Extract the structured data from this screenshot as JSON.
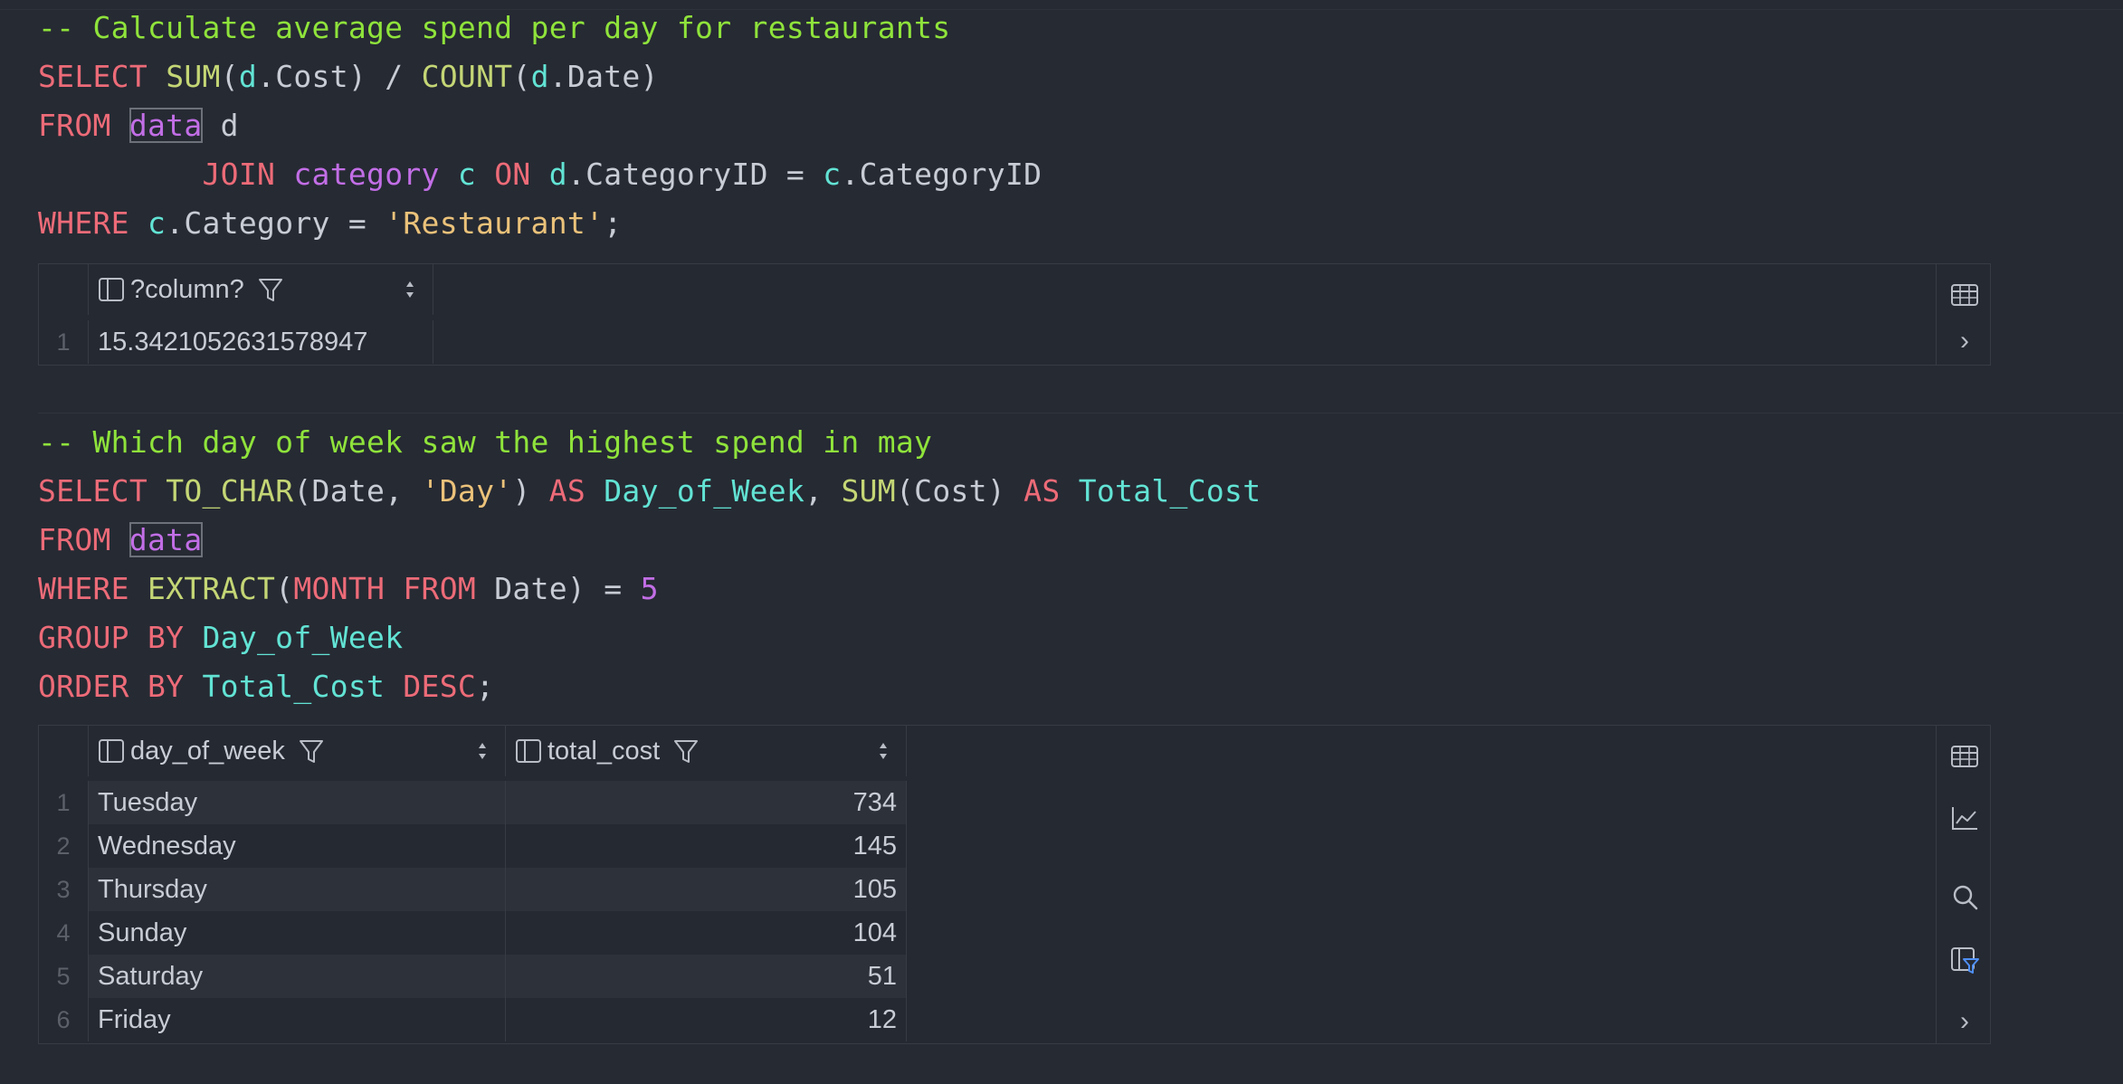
{
  "query1": {
    "lines": [
      [
        {
          "t": "-- Calculate average spend per day for restaurants",
          "c": "cmt"
        }
      ],
      [
        {
          "t": "SELECT ",
          "c": "kw"
        },
        {
          "t": "SUM",
          "c": "fn"
        },
        {
          "t": "(",
          "c": "pl"
        },
        {
          "t": "d",
          "c": "vr"
        },
        {
          "t": ".Cost) / ",
          "c": "pl"
        },
        {
          "t": "COUNT",
          "c": "fn"
        },
        {
          "t": "(",
          "c": "pl"
        },
        {
          "t": "d",
          "c": "vr"
        },
        {
          "t": ".Date)",
          "c": "pl"
        }
      ],
      [
        {
          "t": "FROM ",
          "c": "kw"
        },
        {
          "t": "data",
          "c": "tb"
        },
        {
          "t": " d",
          "c": "pl"
        }
      ],
      [
        {
          "t": "         JOIN ",
          "c": "kw"
        },
        {
          "t": "category",
          "c": "tbn"
        },
        {
          "t": " c ",
          "c": "vr"
        },
        {
          "t": "ON ",
          "c": "kw"
        },
        {
          "t": "d",
          "c": "vr"
        },
        {
          "t": ".CategoryID = ",
          "c": "pl"
        },
        {
          "t": "c",
          "c": "vr"
        },
        {
          "t": ".CategoryID",
          "c": "pl"
        }
      ],
      [
        {
          "t": "WHERE ",
          "c": "kw"
        },
        {
          "t": "c",
          "c": "vr"
        },
        {
          "t": ".Category = ",
          "c": "pl"
        },
        {
          "t": "'Restaurant'",
          "c": "str"
        },
        {
          "t": ";",
          "c": "pl"
        }
      ]
    ]
  },
  "result1": {
    "column": "?column?",
    "rows": [
      {
        "n": "1",
        "value": "15.3421052631578947"
      }
    ]
  },
  "query2": {
    "lines": [
      [
        {
          "t": "-- Which day of week saw the highest spend in may",
          "c": "cmt"
        }
      ],
      [
        {
          "t": "SELECT ",
          "c": "kw"
        },
        {
          "t": "TO_CHAR",
          "c": "fn"
        },
        {
          "t": "(Date, ",
          "c": "pl"
        },
        {
          "t": "'Day'",
          "c": "str"
        },
        {
          "t": ") ",
          "c": "pl"
        },
        {
          "t": "AS ",
          "c": "kw"
        },
        {
          "t": "Day_of_Week",
          "c": "vr"
        },
        {
          "t": ", ",
          "c": "pl"
        },
        {
          "t": "SUM",
          "c": "fn"
        },
        {
          "t": "(Cost) ",
          "c": "pl"
        },
        {
          "t": "AS ",
          "c": "kw"
        },
        {
          "t": "Total_Cost",
          "c": "vr"
        }
      ],
      [
        {
          "t": "FROM ",
          "c": "kw"
        },
        {
          "t": "data",
          "c": "tb"
        }
      ],
      [
        {
          "t": "WHERE ",
          "c": "kw"
        },
        {
          "t": "EXTRACT",
          "c": "fn"
        },
        {
          "t": "(",
          "c": "pl"
        },
        {
          "t": "MONTH FROM ",
          "c": "kw"
        },
        {
          "t": "Date) = ",
          "c": "pl"
        },
        {
          "t": "5",
          "c": "num"
        }
      ],
      [
        {
          "t": "GROUP BY ",
          "c": "kw"
        },
        {
          "t": "Day_of_Week",
          "c": "vr"
        }
      ],
      [
        {
          "t": "ORDER BY ",
          "c": "kw"
        },
        {
          "t": "Total_Cost ",
          "c": "vr"
        },
        {
          "t": "DESC",
          "c": "kw"
        },
        {
          "t": ";",
          "c": "pl"
        }
      ]
    ]
  },
  "result2": {
    "columns": [
      "day_of_week",
      "total_cost"
    ],
    "rows": [
      {
        "n": "1",
        "day": "Tuesday",
        "cost": "734"
      },
      {
        "n": "2",
        "day": "Wednesday",
        "cost": "145"
      },
      {
        "n": "3",
        "day": "Thursday",
        "cost": "105"
      },
      {
        "n": "4",
        "day": "Sunday",
        "cost": "104"
      },
      {
        "n": "5",
        "day": "Saturday",
        "cost": "51"
      },
      {
        "n": "6",
        "day": "Friday",
        "cost": "12"
      }
    ]
  },
  "icons": {
    "table": "table-view-icon",
    "chart": "chart-view-icon",
    "search": "search-icon",
    "filter": "filter-icon",
    "expand": "chevron-right-icon"
  },
  "colors": {
    "background": "#262a33",
    "comment": "#8fe33b",
    "keyword": "#ed6b78",
    "function": "#c4d675",
    "identifier": "#62e3d4",
    "table": "#c26ee6",
    "string": "#ebc27a",
    "accent": "#4f8ff7"
  }
}
